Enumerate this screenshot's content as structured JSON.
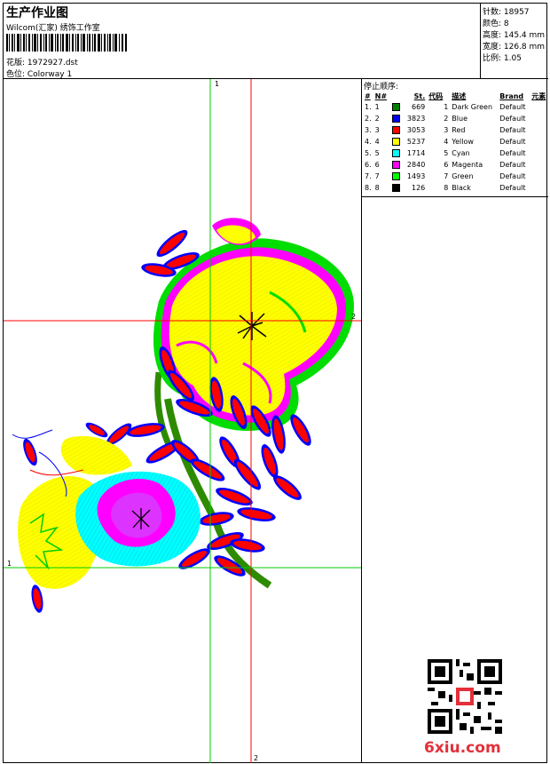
{
  "header": {
    "title": "生产作业图",
    "subtitle": "Wilcom(汇家) 绣饰工作室",
    "design_label": "花版: 1972927.dst",
    "colorway_label": "色位: Colorway 1"
  },
  "stats": {
    "stitches": "针数: 18957",
    "colors": "颜色: 8",
    "height": "高度: 145.4 mm",
    "width": "宽度: 126.8 mm",
    "scale": "比例: 1.05"
  },
  "axes": {
    "v1": "1",
    "h2": "2",
    "h1": "1",
    "v2": "2"
  },
  "stops": {
    "title": "停止顺序:",
    "headers": [
      "#",
      "N#",
      "St.",
      "代码",
      "描述",
      "Brand",
      "元素"
    ],
    "rows": [
      {
        "idx": "1.",
        "n": "1",
        "st": "669",
        "code": "1",
        "desc": "Dark Green",
        "brand": "Default",
        "color": "#008000"
      },
      {
        "idx": "2.",
        "n": "2",
        "st": "3823",
        "code": "2",
        "desc": "Blue",
        "brand": "Default",
        "color": "#0000ff"
      },
      {
        "idx": "3.",
        "n": "3",
        "st": "3053",
        "code": "3",
        "desc": "Red",
        "brand": "Default",
        "color": "#ff0000"
      },
      {
        "idx": "4.",
        "n": "4",
        "st": "5237",
        "code": "4",
        "desc": "Yellow",
        "brand": "Default",
        "color": "#ffff00"
      },
      {
        "idx": "5.",
        "n": "5",
        "st": "1714",
        "code": "5",
        "desc": "Cyan",
        "brand": "Default",
        "color": "#00ffff"
      },
      {
        "idx": "6.",
        "n": "6",
        "st": "2840",
        "code": "6",
        "desc": "Magenta",
        "brand": "Default",
        "color": "#ff00ff"
      },
      {
        "idx": "7.",
        "n": "7",
        "st": "1493",
        "code": "7",
        "desc": "Green",
        "brand": "Default",
        "color": "#00ff00"
      },
      {
        "idx": "8.",
        "n": "8",
        "st": "126",
        "code": "8",
        "desc": "Black",
        "brand": "Default",
        "color": "#000000"
      }
    ]
  },
  "footer": {
    "brand": "6xiu.com"
  }
}
